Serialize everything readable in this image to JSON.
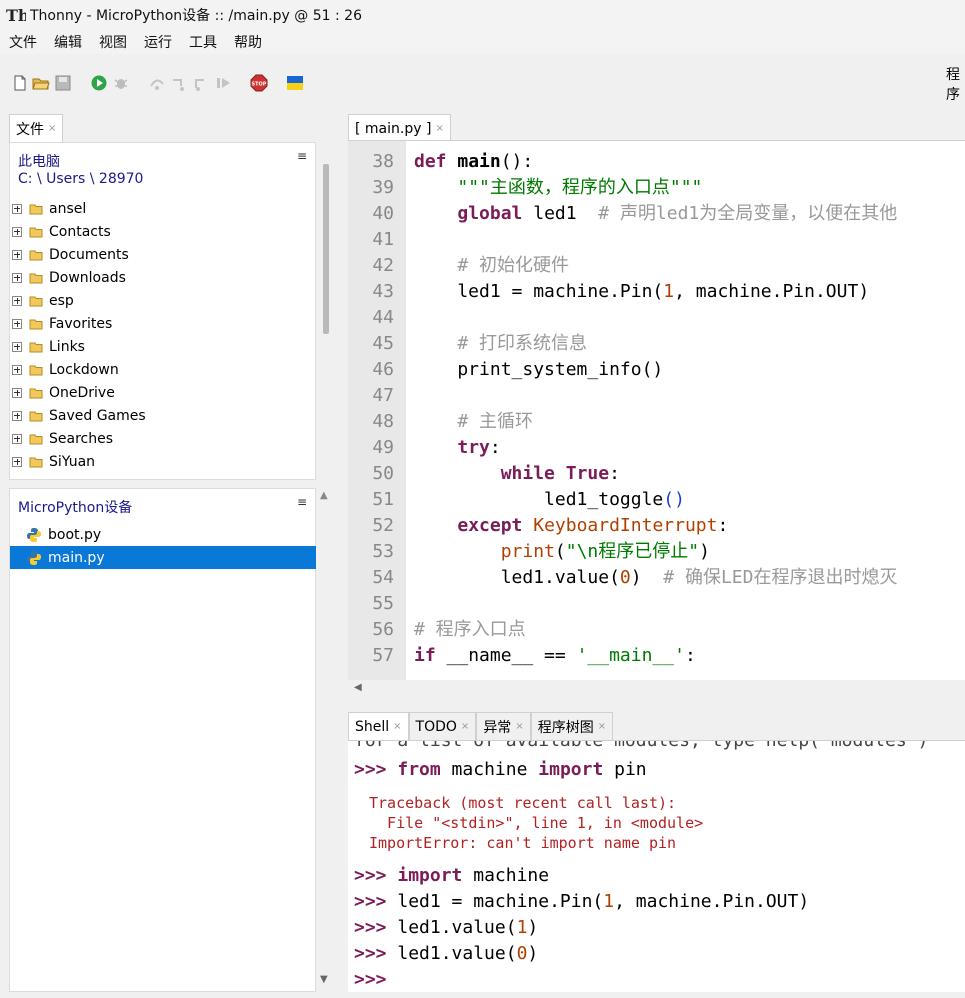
{
  "window": {
    "title": "Thonny  -  MicroPython设备 :: /main.py  @  51 : 26"
  },
  "menu": [
    "文件",
    "编辑",
    "视图",
    "运行",
    "工具",
    "帮助"
  ],
  "toolbar": {
    "icons": [
      "new-file-icon",
      "open-file-icon",
      "save-icon",
      "run-icon",
      "debug-icon",
      "step-over-icon",
      "step-into-icon",
      "step-out-icon",
      "resume-icon",
      "stop-icon",
      "ukraine-flag-icon"
    ],
    "right_text": "程序"
  },
  "files_tab": {
    "label": "文件",
    "close": "×"
  },
  "files": {
    "location": "此电脑",
    "path": "C: \\ Users \\ 28970",
    "menu_glyph": "≡",
    "folders": [
      "ansel",
      "Contacts",
      "Documents",
      "Downloads",
      "esp",
      "Favorites",
      "Links",
      "Lockdown",
      "OneDrive",
      "Saved Games",
      "Searches",
      "SiYuan"
    ]
  },
  "device": {
    "header": "MicroPython设备",
    "menu_glyph": "≡",
    "files": [
      {
        "name": "boot.py",
        "selected": false
      },
      {
        "name": "main.py",
        "selected": true
      }
    ]
  },
  "editor_tab": {
    "label": "[ main.py ]",
    "close": "×"
  },
  "editor": {
    "line_numbers": [
      "38",
      "39",
      "40",
      "41",
      "42",
      "43",
      "44",
      "45",
      "46",
      "47",
      "48",
      "49",
      "50",
      "51",
      "52",
      "53",
      "54",
      "55",
      "56",
      "57"
    ],
    "lines": [
      "def main():",
      "    \"\"\"主函数，程序的入口点\"\"\"",
      "    global led1  # 声明led1为全局变量，以便在其他",
      "",
      "    # 初始化硬件",
      "    led1 = machine.Pin(1, machine.Pin.OUT)",
      "",
      "    # 打印系统信息",
      "    print_system_info()",
      "",
      "    # 主循环",
      "    try:",
      "        while True:",
      "            led1_toggle()",
      "    except KeyboardInterrupt:",
      "        print(\"\\n程序已停止\")",
      "        led1.value(0)  # 确保LED在程序退出时熄灭",
      "",
      "# 程序入口点",
      "if __name__ == '__main__':"
    ]
  },
  "bottom_tabs": [
    "Shell",
    "TODO",
    "异常",
    "程序树图"
  ],
  "shell": {
    "cut_line": "for a list of available modules, type help('modules')",
    "prompt": ">>>",
    "cmd1": "from machine import pin",
    "error": [
      "Traceback (most recent call last):",
      "  File \"<stdin>\", line 1, in <module>",
      "ImportError: can't import name pin"
    ],
    "cmd2": "import machine",
    "cmd3": "led1 = machine.Pin(1, machine.Pin.OUT)",
    "cmd4": "led1.value(1)",
    "cmd5": "led1.value(0)"
  }
}
